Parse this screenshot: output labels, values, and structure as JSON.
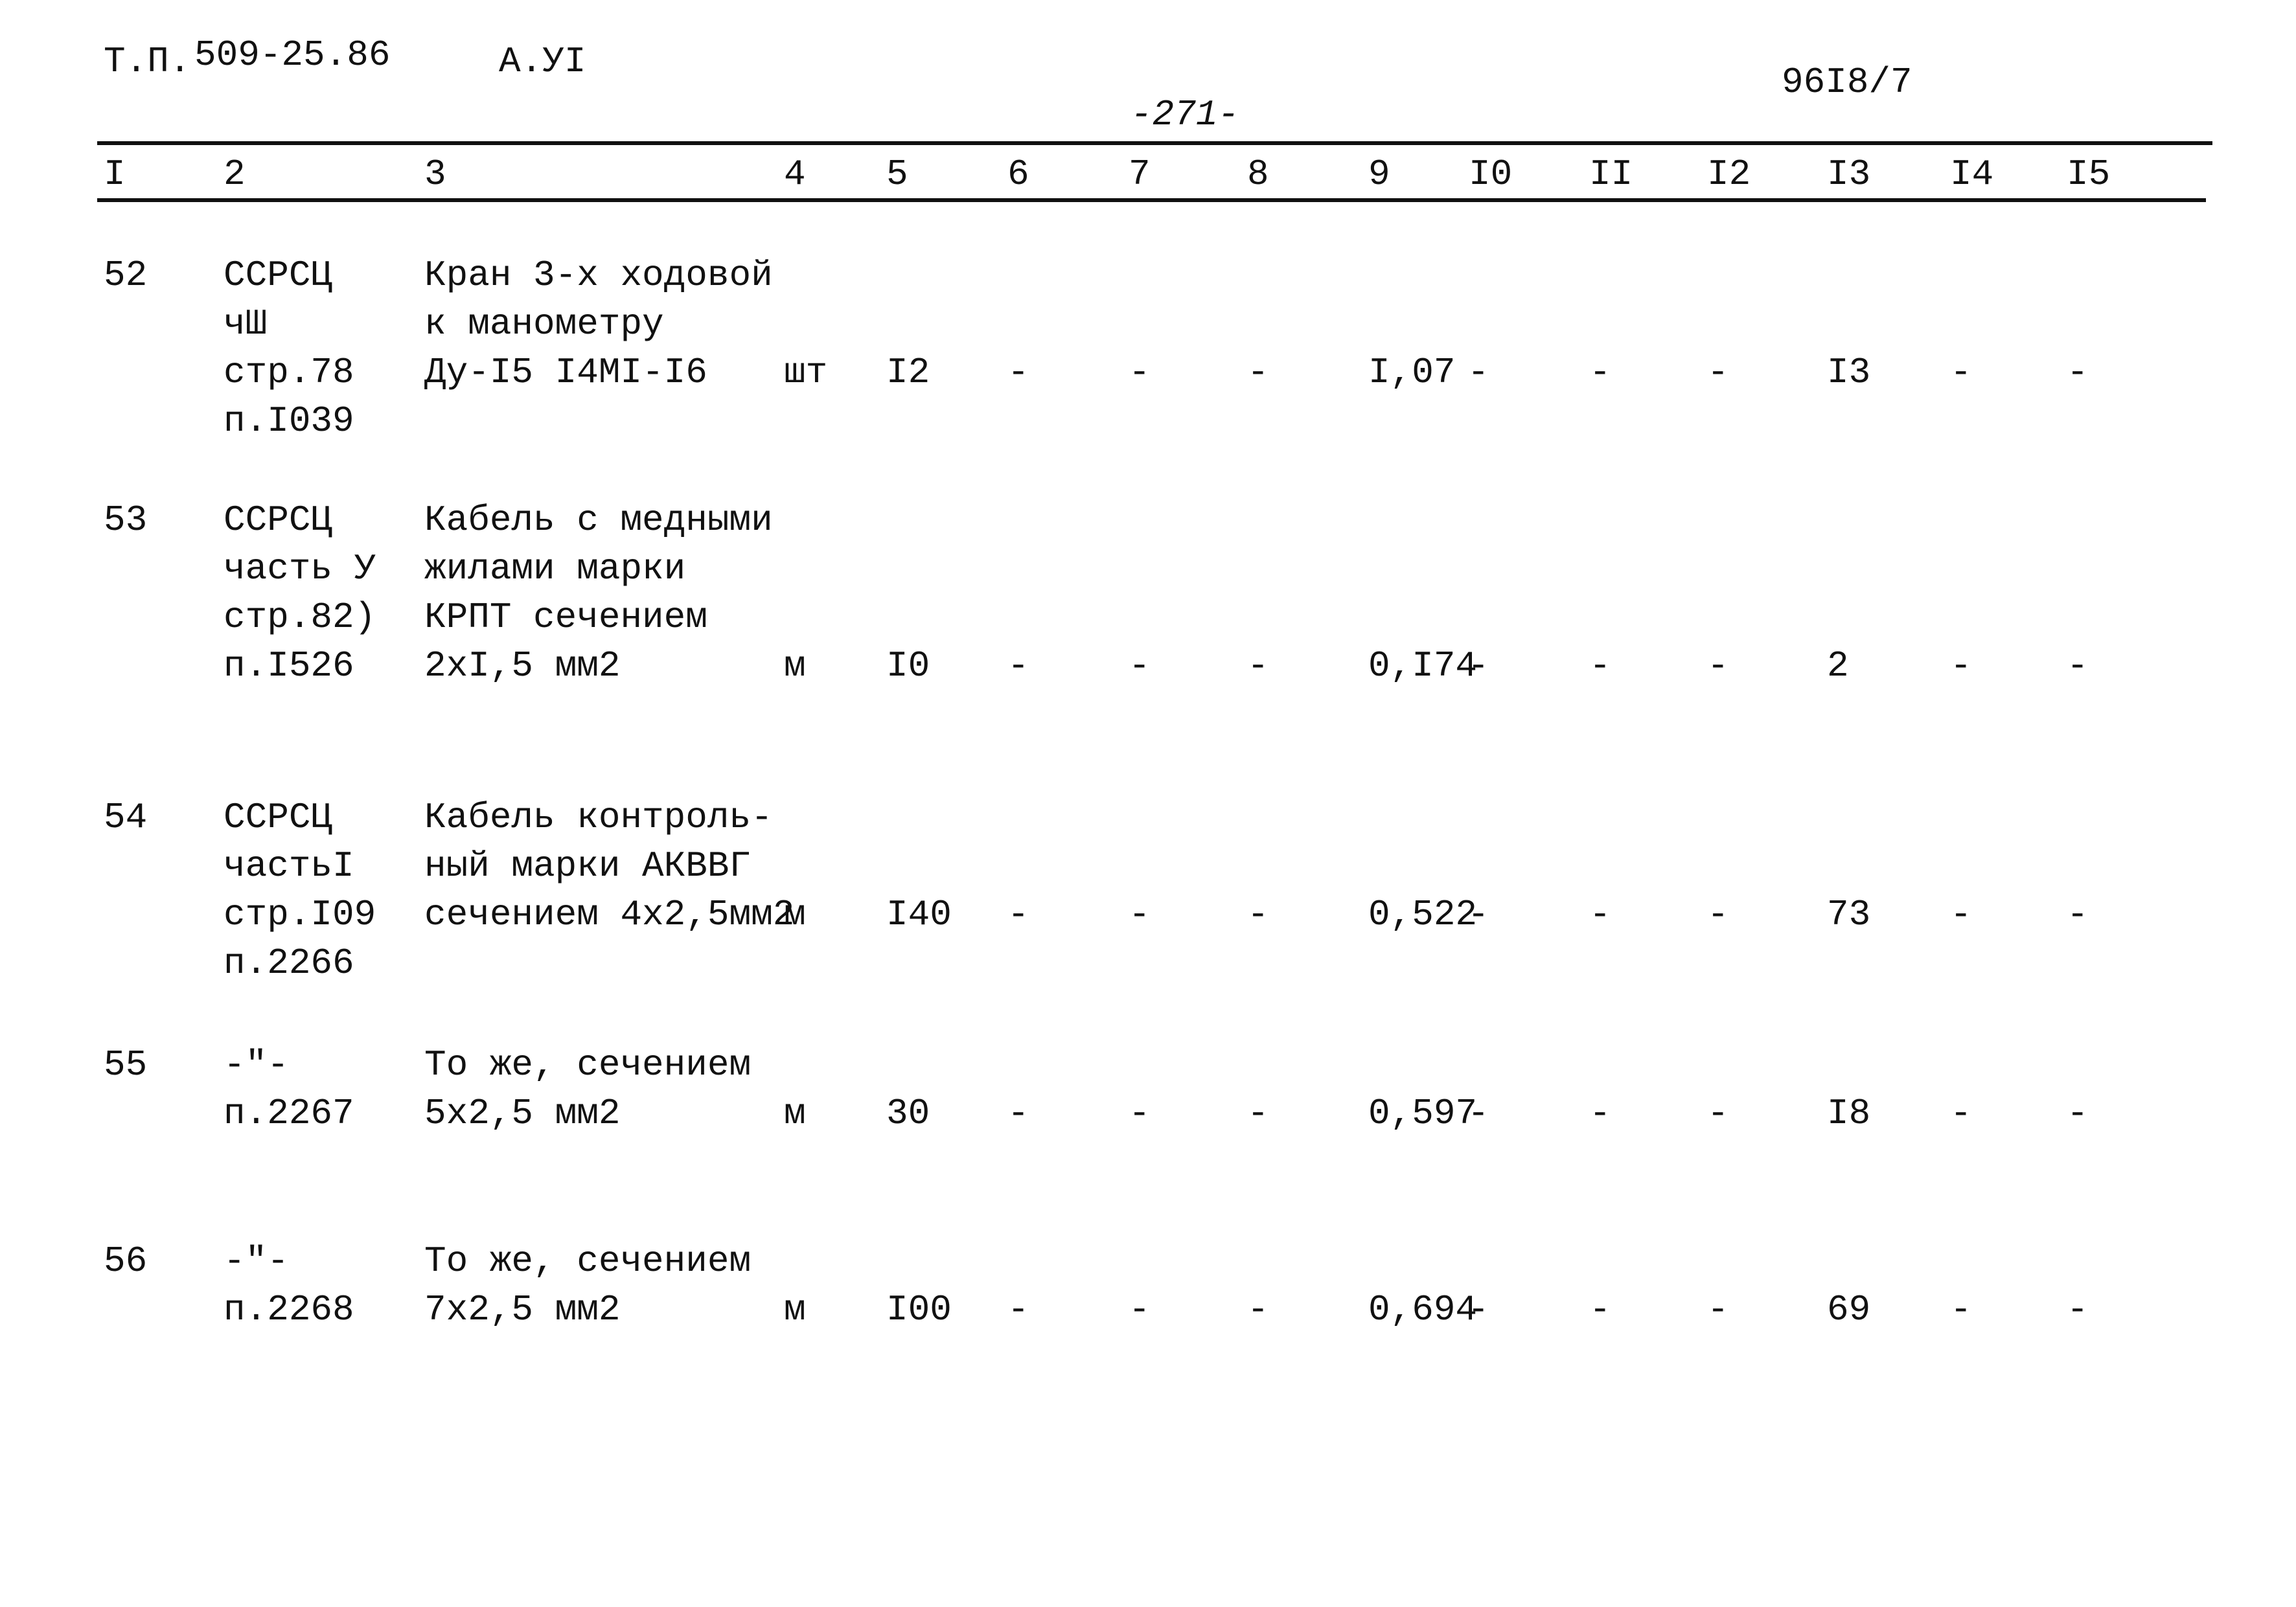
{
  "header": {
    "doc_code_prefix": "Т.П.",
    "doc_code": "509-25.86",
    "album": "А.УI",
    "page_number": "-271-",
    "sheet_ref": "96I8/7"
  },
  "table": {
    "columns": [
      "I",
      "2",
      "3",
      "4",
      "5",
      "6",
      "7",
      "8",
      "9",
      "I0",
      "II",
      "I2",
      "I3",
      "I4",
      "I5"
    ],
    "rows": [
      {
        "num": "52",
        "source": [
          "ССРСЦ",
          "чШ",
          "стр.78",
          "п.I039"
        ],
        "name": [
          "Кран 3-х ходовой",
          "к манометру",
          "Ду-I5 I4МI-I6"
        ],
        "unit": "шт",
        "c5": "I2",
        "c6": "-",
        "c7": "-",
        "c8": "-",
        "c9": "I,07",
        "c10": "-",
        "c11": "-",
        "c12": "-",
        "c13": "I3",
        "c14": "-",
        "c15": "-"
      },
      {
        "num": "53",
        "source": [
          "ССРСЦ",
          "часть У",
          "стр.82)",
          "п.I526"
        ],
        "name": [
          "Кабель с медными",
          "жилами марки",
          "КРПТ сечением",
          "2хI,5 мм2"
        ],
        "unit": "м",
        "c5": "I0",
        "c6": "-",
        "c7": "-",
        "c8": "-",
        "c9": "0,I74",
        "c10": "-",
        "c11": "-",
        "c12": "-",
        "c13": "2",
        "c14": "-",
        "c15": "-"
      },
      {
        "num": "54",
        "source": [
          "ССРСЦ",
          "частьI",
          "стр.I09",
          "п.2266"
        ],
        "name": [
          "Кабель контроль-",
          "ный марки АКВВГ",
          "сечением 4х2,5мм2"
        ],
        "unit": "м",
        "c5": "I40",
        "c6": "-",
        "c7": "-",
        "c8": "-",
        "c9": "0,522",
        "c10": "-",
        "c11": "-",
        "c12": "-",
        "c13": "73",
        "c14": "-",
        "c15": "-"
      },
      {
        "num": "55",
        "source": [
          "-\"-",
          "п.2267"
        ],
        "name": [
          "То же, сечением",
          "5х2,5 мм2"
        ],
        "unit": "м",
        "c5": "30",
        "c6": "-",
        "c7": "-",
        "c8": "-",
        "c9": "0,597",
        "c10": "-",
        "c11": "-",
        "c12": "-",
        "c13": "I8",
        "c14": "-",
        "c15": "-"
      },
      {
        "num": "56",
        "source": [
          "-\"-",
          "п.2268"
        ],
        "name": [
          "То же, сечением",
          "7х2,5 мм2"
        ],
        "unit": "м",
        "c5": "I00",
        "c6": "-",
        "c7": "-",
        "c8": "-",
        "c9": "0,694",
        "c10": "-",
        "c11": "-",
        "c12": "-",
        "c13": "69",
        "c14": "-",
        "c15": "-"
      }
    ]
  }
}
